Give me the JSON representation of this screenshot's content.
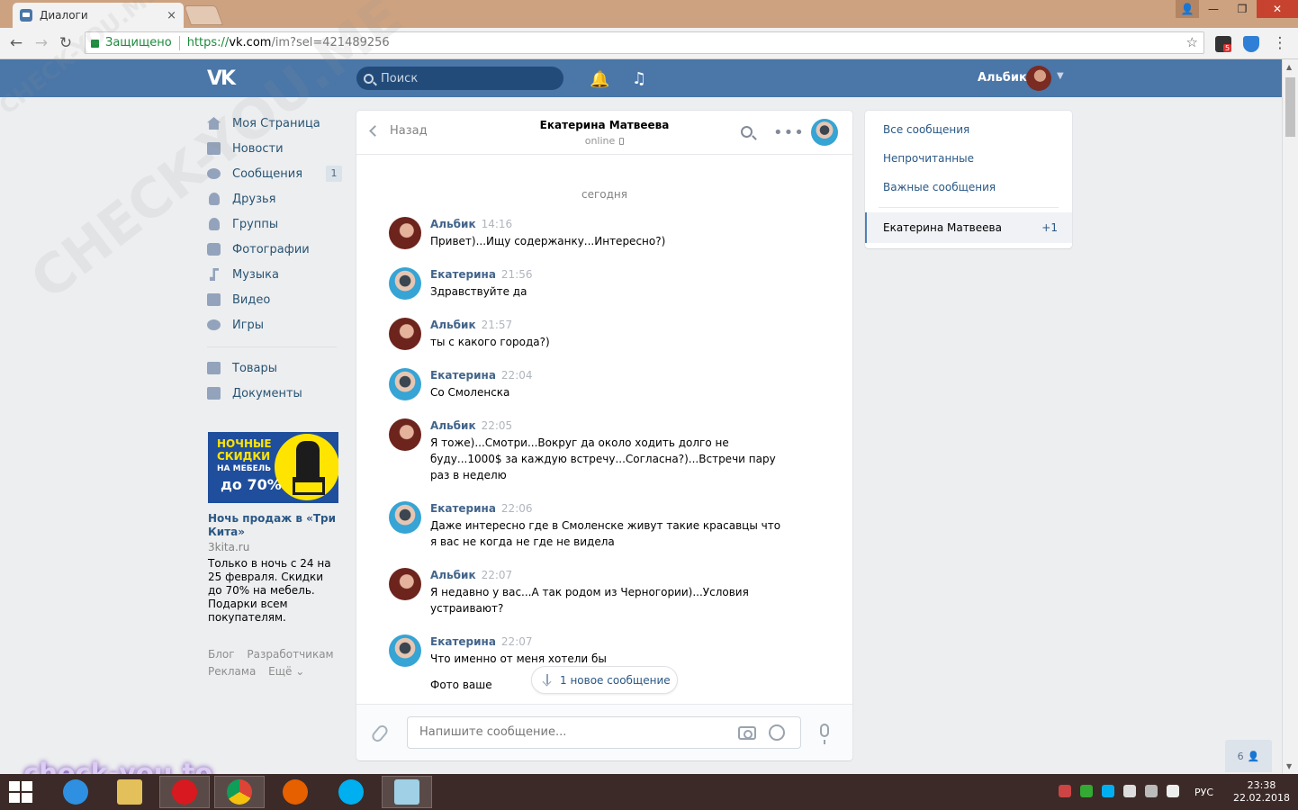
{
  "browser": {
    "tab_title": "Диалоги",
    "tab_close": "×",
    "secure_label": "Защищено",
    "url_scheme": "https://",
    "url_host": "vk.com",
    "url_path": "/im?sel=421489256",
    "extension_badge": "5"
  },
  "vk_header": {
    "logo": "VK",
    "search_placeholder": "Поиск",
    "user_name": "Альбик"
  },
  "left_menu": {
    "items": [
      {
        "label": "Моя Страница",
        "icon": "home-icon"
      },
      {
        "label": "Новости",
        "icon": "news-icon"
      },
      {
        "label": "Сообщения",
        "icon": "messages-icon",
        "badge": "1"
      },
      {
        "label": "Друзья",
        "icon": "friends-icon"
      },
      {
        "label": "Группы",
        "icon": "groups-icon"
      },
      {
        "label": "Фотографии",
        "icon": "photos-icon"
      },
      {
        "label": "Музыка",
        "icon": "music-icon"
      },
      {
        "label": "Видео",
        "icon": "video-icon"
      },
      {
        "label": "Игры",
        "icon": "games-icon"
      }
    ],
    "secondary": [
      {
        "label": "Товары",
        "icon": "goods-icon"
      },
      {
        "label": "Документы",
        "icon": "documents-icon"
      }
    ]
  },
  "ad": {
    "image_line1": "НОЧНЫЕ",
    "image_line2": "СКИДКИ",
    "image_line3": "НА МЕБЕЛЬ",
    "image_line4": "до 70%",
    "title": "Ночь продаж в «Три Кита»",
    "domain": "3kita.ru",
    "text": "Только в ночь с 24 на 25 февраля. Скидки до 70% на мебель. Подарки всем покупателям."
  },
  "footer": {
    "links": [
      "Блог",
      "Разработчикам",
      "Реклама",
      "Ещё ⌄"
    ]
  },
  "dialog": {
    "back_label": "Назад",
    "peer_name": "Екатерина Матвеева",
    "peer_status": "online",
    "date_separator": "сегодня",
    "messages": [
      {
        "author": "Альбик",
        "time": "14:16",
        "text": "Привет)...Ищу содержанку...Интересно?)"
      },
      {
        "author": "Екатерина",
        "time": "21:56",
        "text": "Здравствуйте да"
      },
      {
        "author": "Альбик",
        "time": "21:57",
        "text": "ты с какого города?)"
      },
      {
        "author": "Екатерина",
        "time": "22:04",
        "text": "Со Смоленска"
      },
      {
        "author": "Альбик",
        "time": "22:05",
        "text": "Я тоже)...Смотри...Вокруг да около ходить долго не буду...1000$ за каждую встречу...Согласна?)...Встречи пару раз в неделю"
      },
      {
        "author": "Екатерина",
        "time": "22:06",
        "text": "Даже интересно где в Смоленске живут такие красавцы что я вас не когда не где не видела"
      },
      {
        "author": "Альбик",
        "time": "22:07",
        "text": "Я недавно у вас...А так родом из Черногории)...Условия устраивают?"
      },
      {
        "author": "Екатерина",
        "time": "22:07",
        "text": "Что именно от меня хотели бы"
      }
    ],
    "partial_message": "Фото ваше",
    "new_message_button": "1 новое сообщение",
    "composer_placeholder": "Напишите сообщение..."
  },
  "right_panel": {
    "filters": [
      "Все сообщения",
      "Непрочитанные",
      "Важные сообщения"
    ],
    "active_dialog": "Екатерина Матвеева",
    "active_count": "+1"
  },
  "online_friends": "6",
  "watermarks": {
    "diagonal": "CHECK-YOU.ME",
    "logo": "check-you.to"
  },
  "taskbar": {
    "lang": "РУС",
    "time": "23:38",
    "date": "22.02.2018"
  }
}
